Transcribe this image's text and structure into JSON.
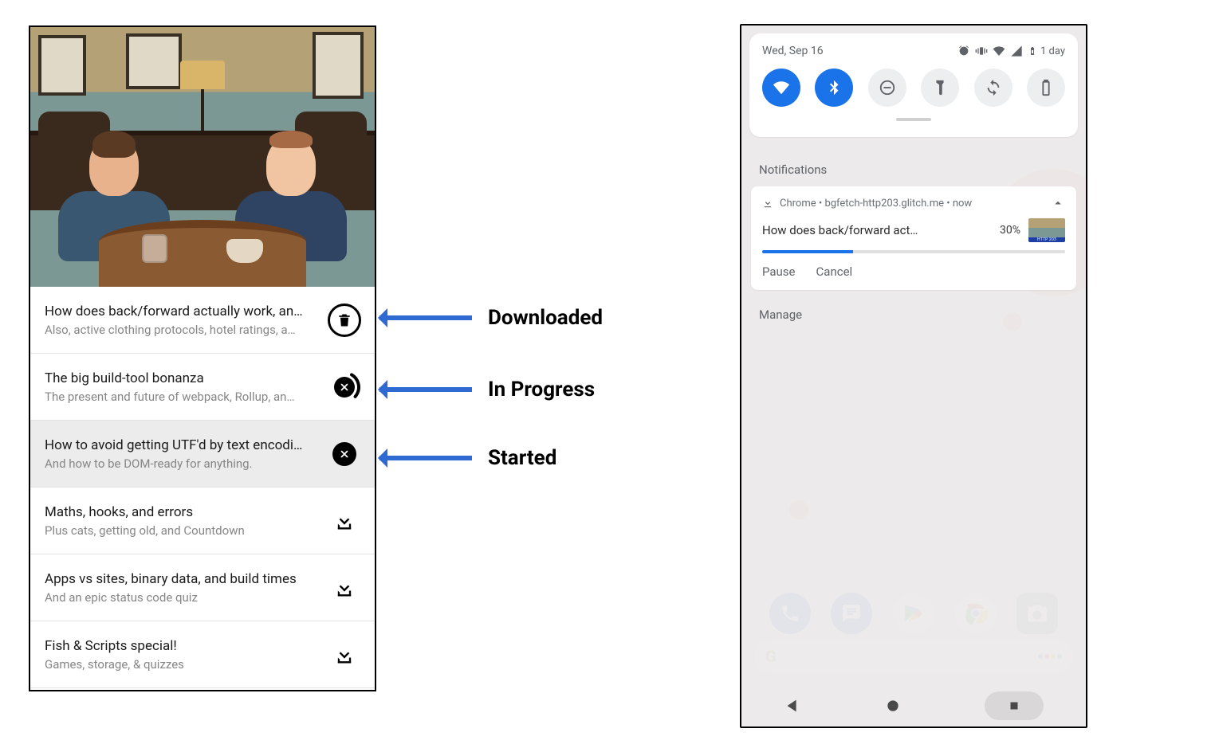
{
  "annotations": {
    "downloaded": "Downloaded",
    "in_progress": "In Progress",
    "started": "Started"
  },
  "episodes": [
    {
      "title": "How does back/forward actually work, an…",
      "sub": "Also, active clothing protocols, hotel ratings, a…",
      "state": "downloaded"
    },
    {
      "title": "The big build-tool bonanza",
      "sub": "The present and future of webpack, Rollup, an…",
      "state": "in_progress",
      "progress": 0.28
    },
    {
      "title": "How to avoid getting UTF'd by text encodi…",
      "sub": "And how to be DOM-ready for anything.",
      "state": "started",
      "highlight": true
    },
    {
      "title": "Maths, hooks, and errors",
      "sub": "Plus cats, getting old, and Countdown",
      "state": "none"
    },
    {
      "title": "Apps vs sites, binary data, and build times",
      "sub": "And an epic status code quiz",
      "state": "none"
    },
    {
      "title": "Fish & Scripts special!",
      "sub": "Games, storage, & quizzes",
      "state": "none"
    }
  ],
  "android": {
    "status_date": "Wed, Sep 16",
    "battery_label": "1 day",
    "notifications_label": "Notifications",
    "manage_label": "Manage",
    "notification": {
      "source": "Chrome  •  bgfetch-http203.glitch.me  •  now",
      "title": "How does back/forward act…",
      "percent_label": "30%",
      "percent": 30,
      "pause": "Pause",
      "cancel": "Cancel"
    }
  }
}
